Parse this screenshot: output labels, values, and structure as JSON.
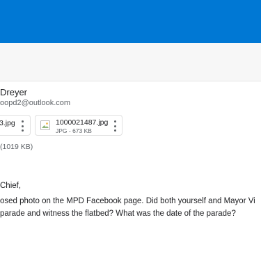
{
  "sender": {
    "name": "Dreyer",
    "email": "oopd2@outlook.com"
  },
  "attachments": [
    {
      "name": "3.jpg"
    },
    {
      "name": "1000021487.jpg",
      "meta": "JPG - 673 KB"
    }
  ],
  "total_size": "(1019 KB)",
  "message": {
    "greeting": "Chief,",
    "line1": "osed photo on the MPD Facebook page. Did both yourself and Mayor Vi",
    "line2": "parade and witness the flatbed? What was the date of the parade?"
  },
  "colors": {
    "header_blue": "#0078d4",
    "toolbar_gray": "#f7f7f7"
  },
  "icons": {
    "attachment_thumb": "image-file-icon",
    "more_options": "kebab-menu-icon"
  }
}
